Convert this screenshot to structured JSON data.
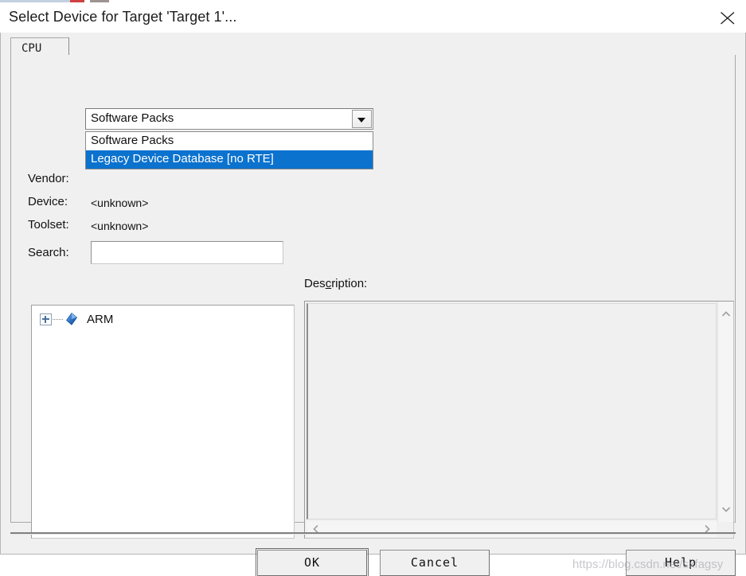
{
  "window": {
    "title": "Select Device for Target 'Target 1'...",
    "close_icon": "close-icon"
  },
  "tabs": [
    {
      "label": "CPU",
      "selected": true
    }
  ],
  "database_combo": {
    "value": "Software Packs",
    "expanded": true,
    "arrow_icon": "chevron-down-icon",
    "options": [
      {
        "label": "Software Packs",
        "selected": false
      },
      {
        "label": "Legacy Device Database [no RTE]",
        "selected": true
      }
    ]
  },
  "fields": {
    "vendor_label": "Vendor:",
    "vendor_value": "",
    "device_label": "Device:",
    "device_value": "<unknown>",
    "toolset_label": "Toolset:",
    "toolset_value": "<unknown>",
    "search_label": "Search:",
    "search_value": "",
    "search_placeholder": ""
  },
  "description": {
    "label_prefix": "Des",
    "label_accel": "c",
    "label_suffix": "ription:",
    "body": "",
    "scroll_up_icon": "chevron-up-icon",
    "scroll_down_icon": "chevron-down-icon",
    "scroll_left_icon": "chevron-left-icon",
    "scroll_right_icon": "chevron-right-icon"
  },
  "device_tree": {
    "nodes": [
      {
        "label": "ARM",
        "expander": "plus-box-icon",
        "node_icon": "blue-diamond-icon",
        "expanded": false
      }
    ]
  },
  "buttons": {
    "ok": "OK",
    "cancel": "Cancel",
    "help": "Help"
  },
  "watermark": {
    "text": "https://blog.csdn.net/sxfagsy"
  },
  "colors": {
    "selection_blue": "#0b72ce",
    "dialog_face": "#f0f0f0",
    "field_white": "#ffffff",
    "border_gray": "#a8a8a8",
    "text": "#111111"
  }
}
